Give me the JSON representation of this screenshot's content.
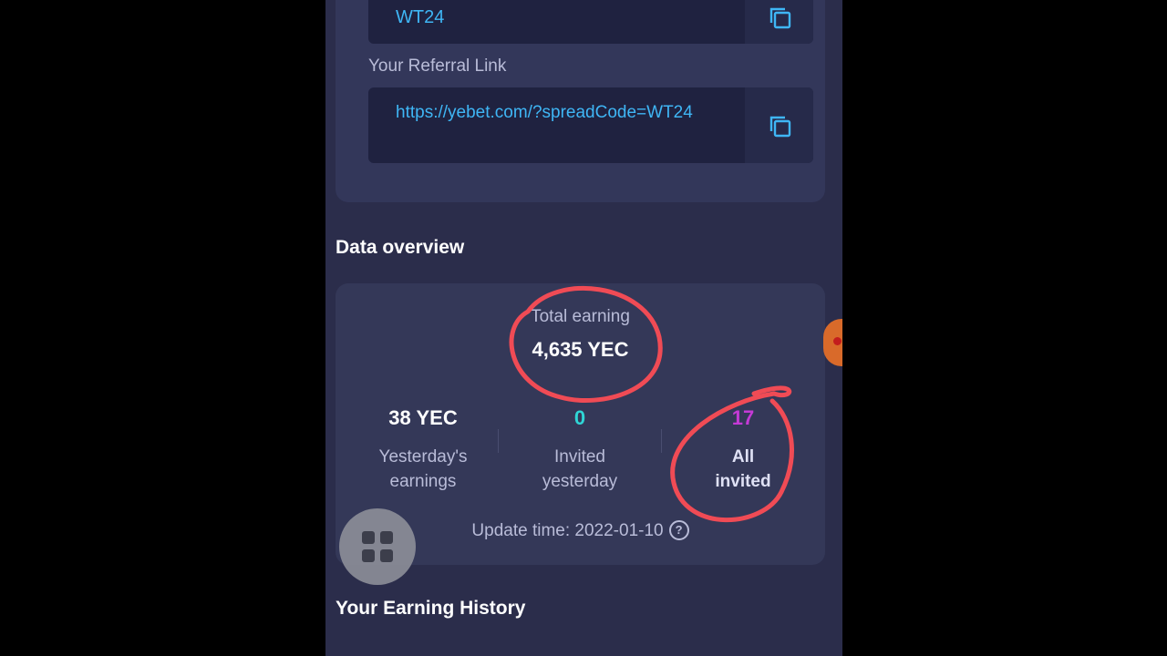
{
  "referral": {
    "code": "WT24",
    "link_label": "Your Referral Link",
    "link": "https://yebet.com/?spreadCode=WT24"
  },
  "data_overview": {
    "title": "Data overview",
    "total_label": "Total earning",
    "total_value": "4,635 YEC",
    "stats": [
      {
        "value": "38 YEC",
        "label": "Yesterday's earnings",
        "color": "#ffffff"
      },
      {
        "value": "0",
        "label": "Invited yesterday",
        "color": "#2fd6d6"
      },
      {
        "value": "17",
        "label": "All invited",
        "color": "#c43ad6"
      }
    ],
    "update_time": "Update time: 2022-01-10",
    "help_icon": "?"
  },
  "earning_history": {
    "title": "Your Earning History"
  },
  "colors": {
    "accent_link": "#3fb6f5",
    "background": "#2b2d4b",
    "annotation": "#f04b55"
  },
  "icons": [
    "copy-icon",
    "help-icon",
    "grid-menu-icon"
  ]
}
